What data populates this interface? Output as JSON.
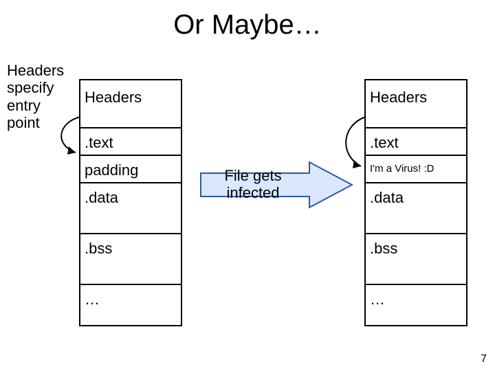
{
  "title": "Or Maybe…",
  "caption": "Headers specify entry point",
  "left": {
    "headers": "Headers",
    "text": ".text",
    "padding": "padding",
    "data": ".data",
    "bss": ".bss",
    "ellipsis": "…"
  },
  "mid_label": "File gets infected",
  "right": {
    "headers": "Headers",
    "text": ".text",
    "virus": "I'm a Virus! :D",
    "data": ".data",
    "bss": ".bss",
    "ellipsis": "…"
  },
  "page_number": "7"
}
